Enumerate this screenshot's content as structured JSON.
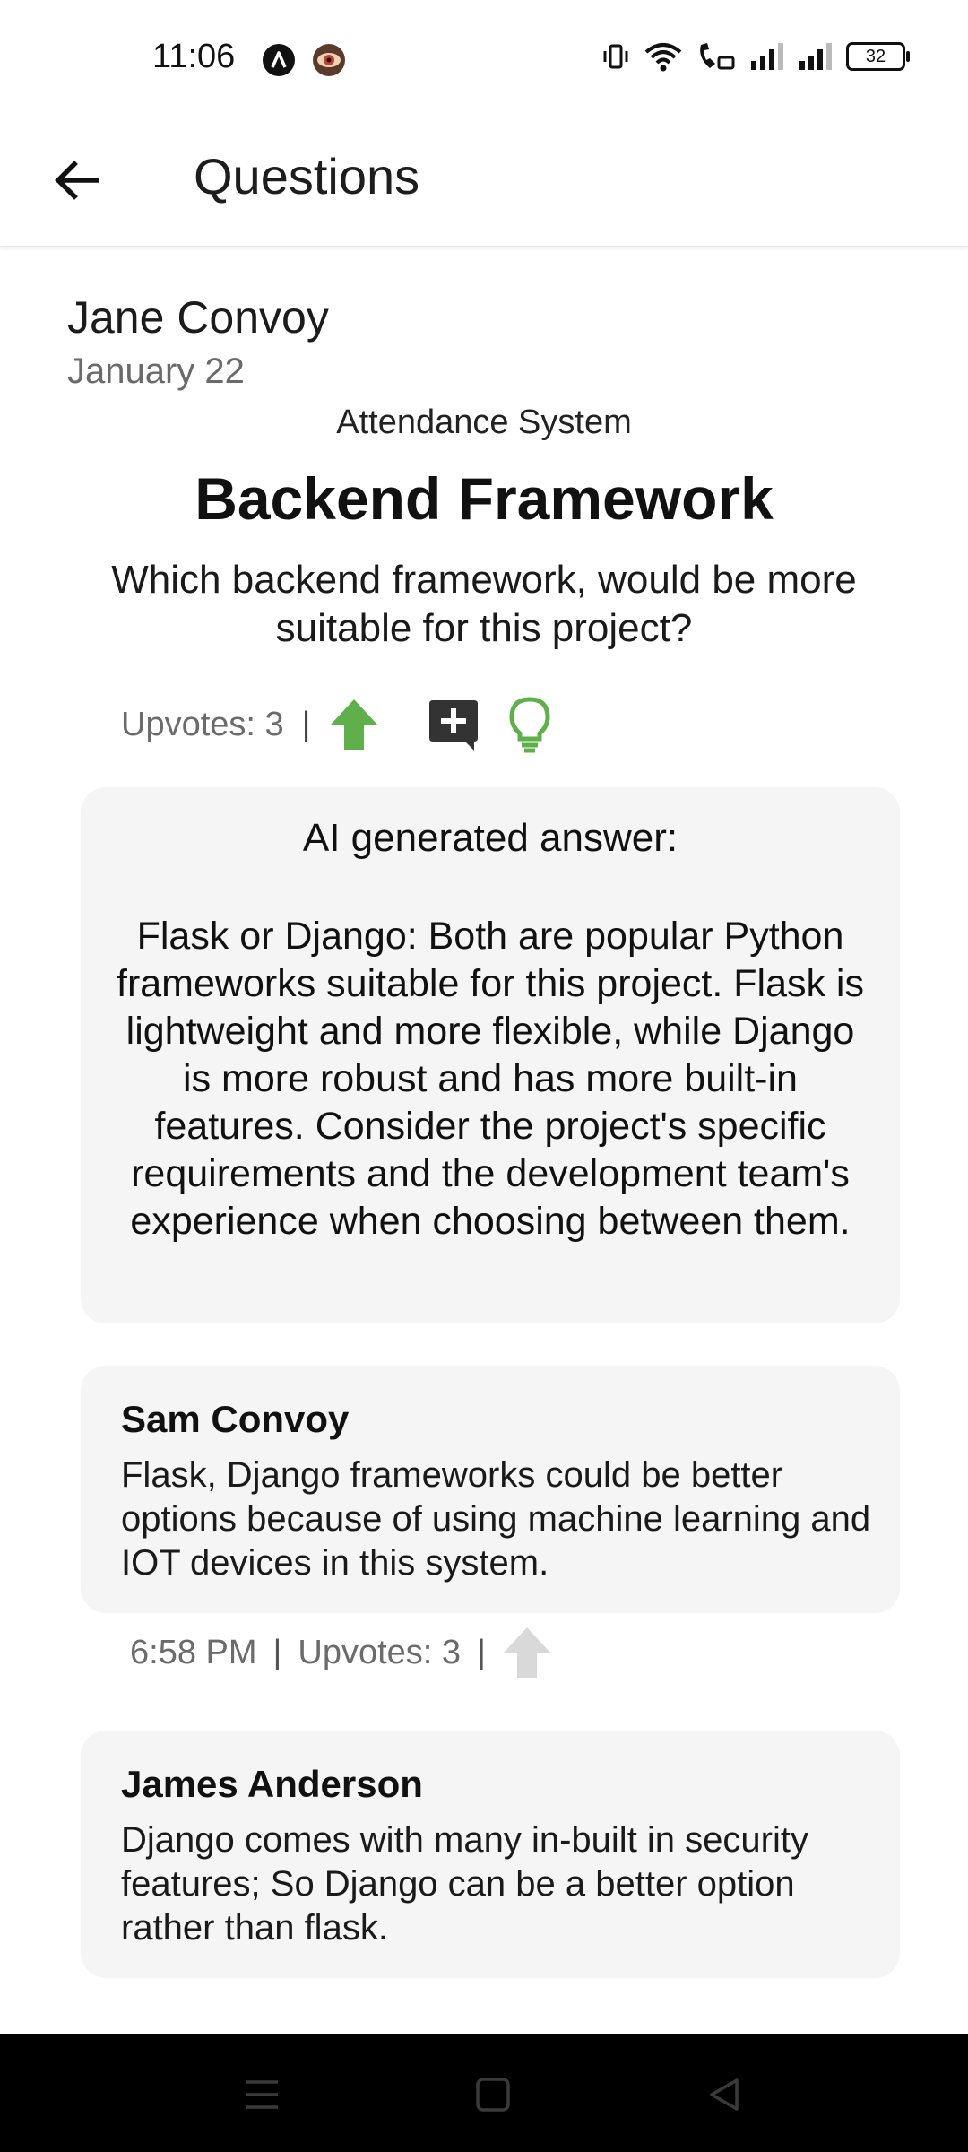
{
  "status_bar": {
    "time": "11:06",
    "battery": "32"
  },
  "app_bar": {
    "title": "Questions"
  },
  "question": {
    "author": "Jane Convoy",
    "date": "January 22",
    "project": "Attendance System",
    "title": "Backend Framework",
    "body": "Which backend framework, would be more suitable for this project?",
    "upvotes_label": "Upvotes: 3",
    "separator": "|"
  },
  "ai_answer": {
    "heading": "AI generated answer:",
    "text": "Flask or Django: Both are popular Python frameworks suitable for this project. Flask is lightweight and more flexible, while Django is more robust and has more built-in features. Consider the project's specific requirements and the development team's experience when choosing between them."
  },
  "answers": [
    {
      "author": "Sam Convoy",
      "text": "Flask, Django frameworks could be better options because of using machine learning and IOT devices in this system.",
      "time": "6:58 PM",
      "upvotes_label": "Upvotes: 3"
    },
    {
      "author": "James Anderson",
      "text": "Django comes with many in-built in security features; So Django can be a better option rather than flask."
    }
  ],
  "colors": {
    "accent_green": "#5fb04a",
    "upvote_inactive": "#d9d9d9",
    "card_bg": "#f5f5f5"
  },
  "icons": {
    "back": "arrow-left-icon",
    "upvote": "arrow-up-icon",
    "comment": "add-comment-icon",
    "ai": "lightbulb-icon"
  }
}
